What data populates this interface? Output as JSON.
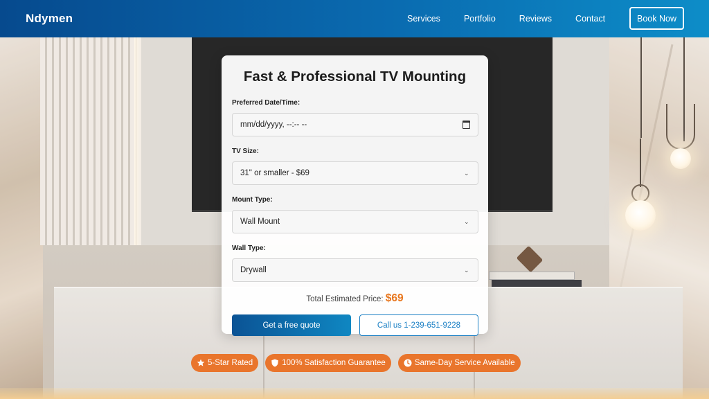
{
  "nav": {
    "brand": "Ndymen",
    "links": [
      "Services",
      "Portfolio",
      "Reviews",
      "Contact"
    ],
    "cta_label": "Book Now"
  },
  "form": {
    "title": "Fast & Professional TV Mounting",
    "date": {
      "label": "Preferred Date/Time:",
      "placeholder": "mm/dd/yyyy, --:-- --",
      "icon": "calendar-icon"
    },
    "tv_size": {
      "label": "TV Size:",
      "value": "31\" or smaller - $69"
    },
    "mount_type": {
      "label": "Mount Type:",
      "value": "Wall Mount"
    },
    "wall_type": {
      "label": "Wall Type:",
      "value": "Drywall"
    },
    "price_label": "Total Estimated Price:",
    "price_value": "$69",
    "quote_button": "Get a free quote",
    "call_button": "Call us 1-239-651-9228"
  },
  "badges": [
    {
      "label": "5-Star Rated",
      "icon": "star-icon"
    },
    {
      "label": "100% Satisfaction Guarantee",
      "icon": "shield-icon"
    },
    {
      "label": "Same-Day Service Available",
      "icon": "clock-icon"
    }
  ],
  "colors": {
    "nav_start": "#064a8e",
    "nav_end": "#0d8dc8",
    "accent_orange": "#e9752c",
    "price_orange": "#e8771f",
    "button_blue": "#1a7fc4"
  }
}
